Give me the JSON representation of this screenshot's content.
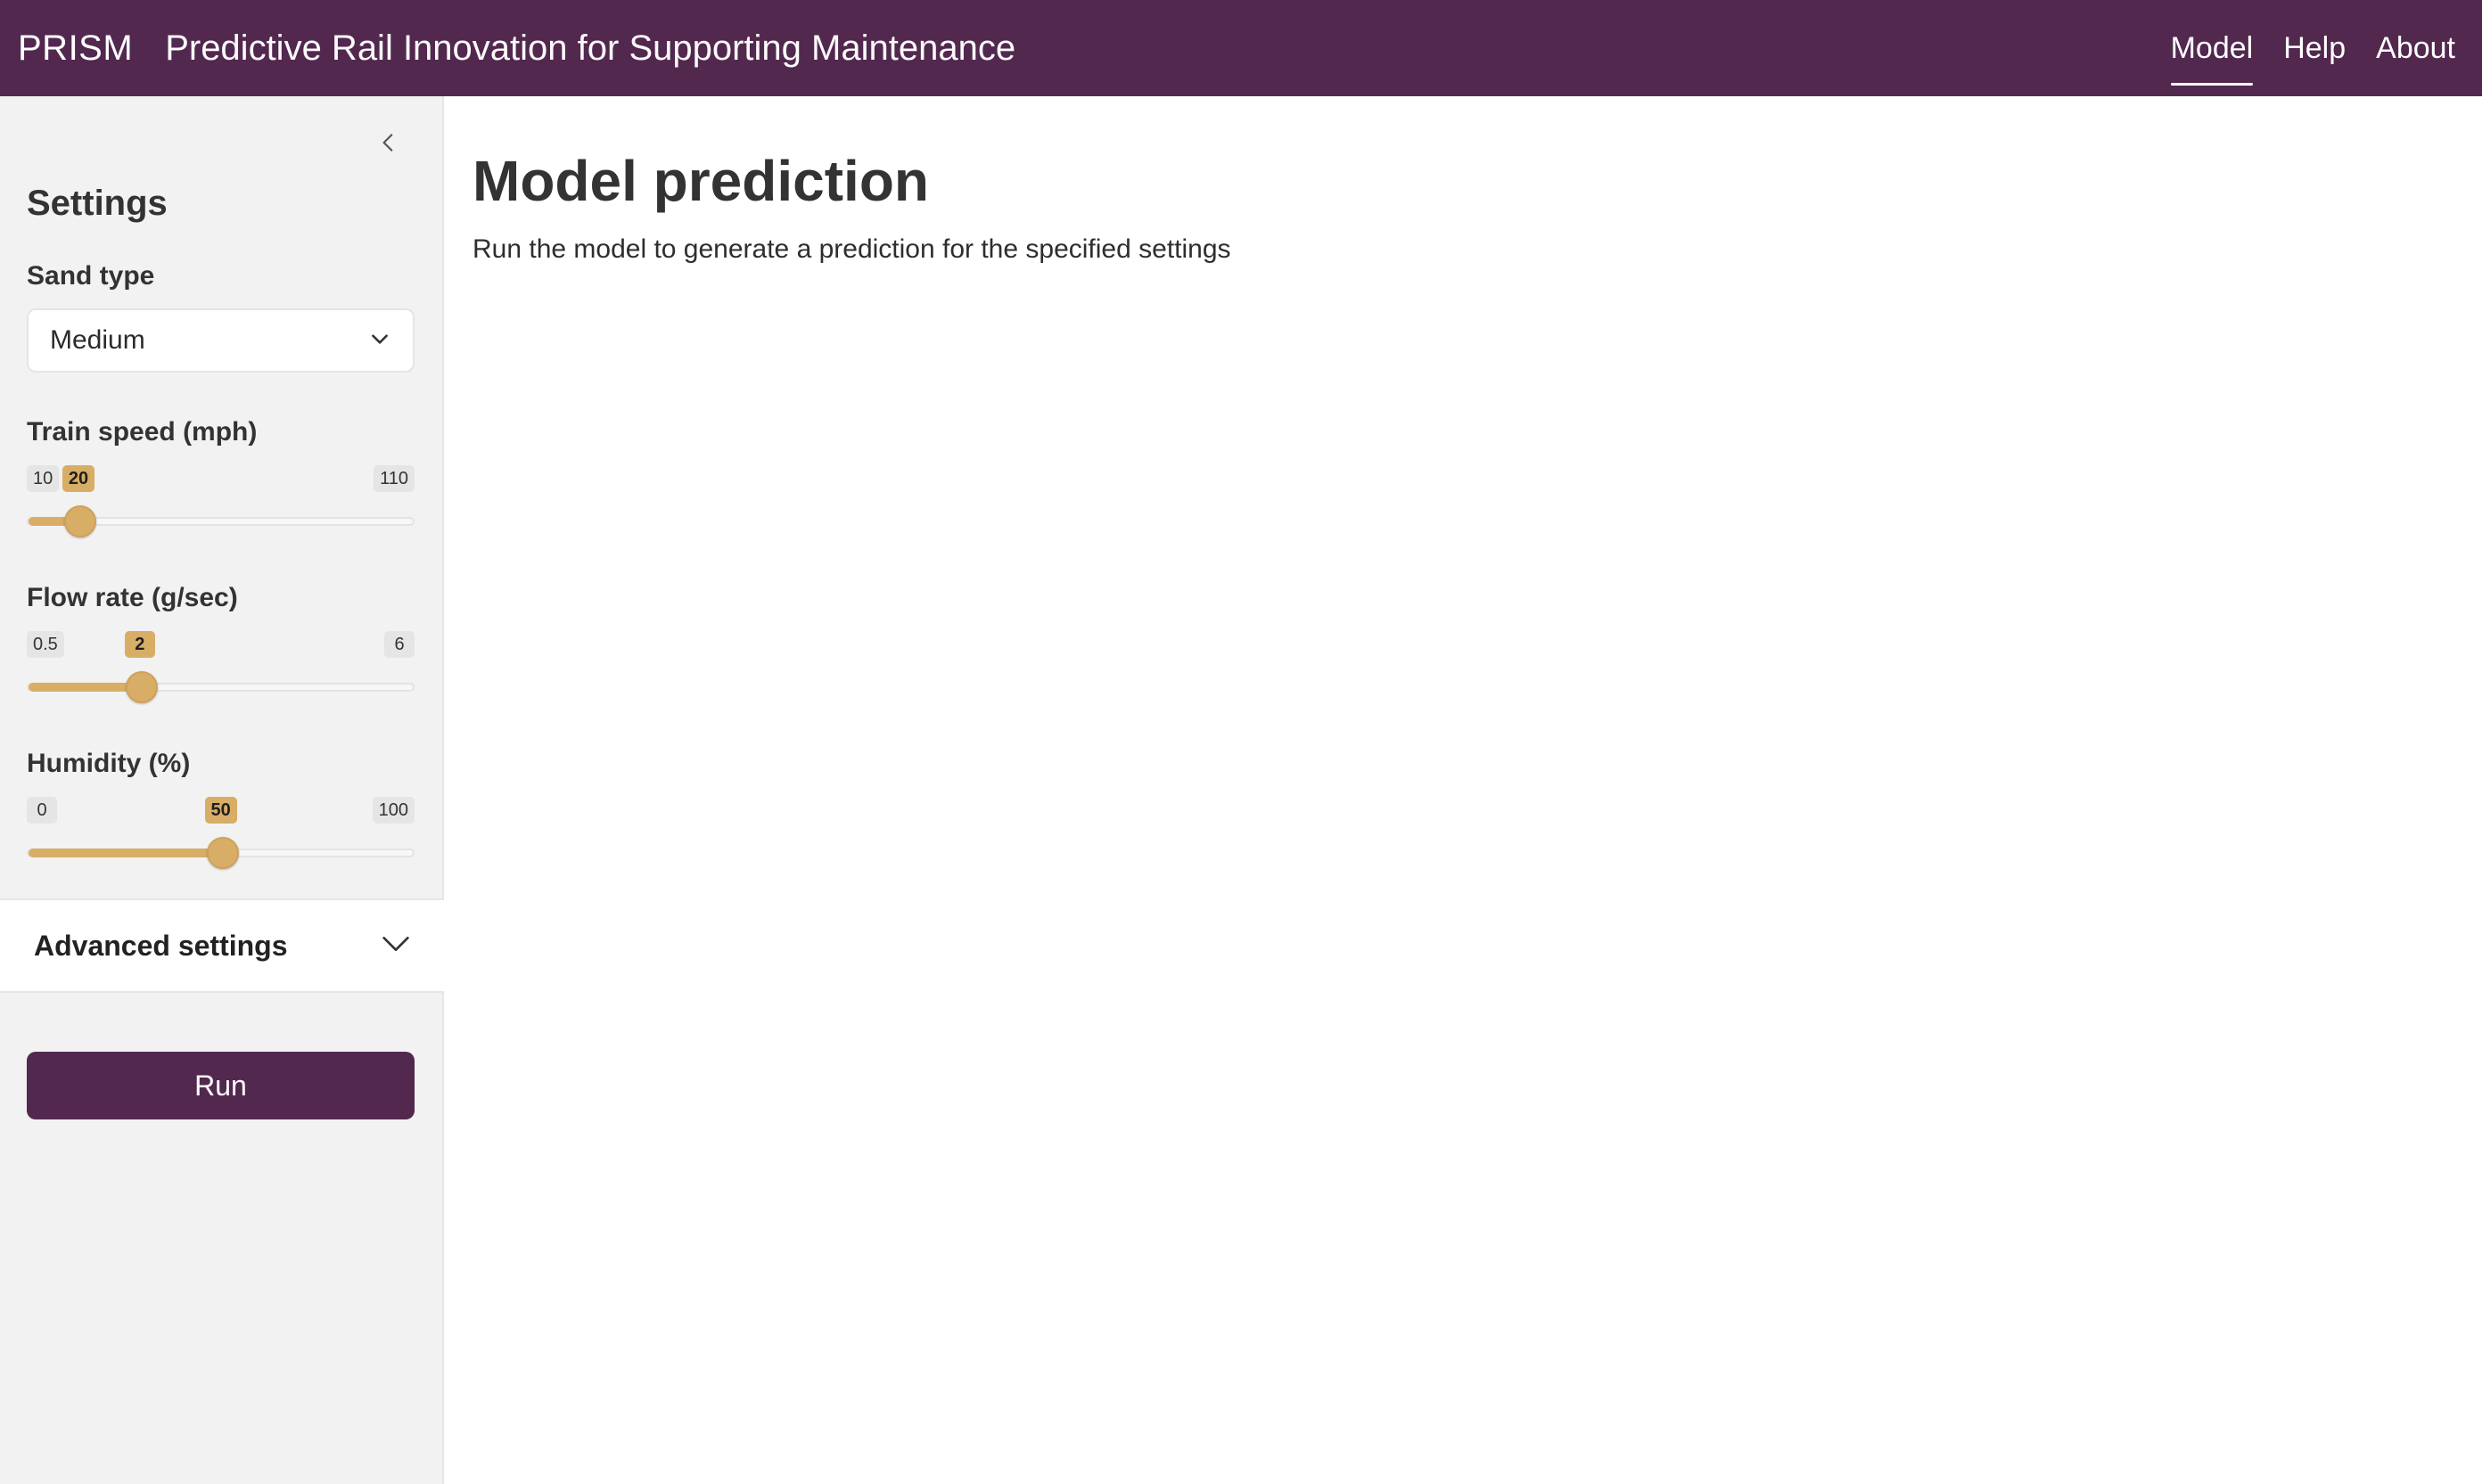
{
  "header": {
    "brand": "PRISM",
    "subtitle": "Predictive Rail Innovation for Supporting Maintenance",
    "nav": [
      {
        "label": "Model",
        "active": true
      },
      {
        "label": "Help",
        "active": false
      },
      {
        "label": "About",
        "active": false
      }
    ],
    "colors": {
      "brand": "#52284f"
    }
  },
  "sidebar": {
    "title": "Settings",
    "sand_type": {
      "label": "Sand type",
      "value": "Medium"
    },
    "sliders": {
      "train_speed": {
        "label": "Train speed (mph)",
        "min": 10,
        "max": 110,
        "value": 20
      },
      "flow_rate": {
        "label": "Flow rate (g/sec)",
        "min": 0.5,
        "max": 6,
        "value": 2
      },
      "humidity": {
        "label": "Humidity (%)",
        "min": 0,
        "max": 100,
        "value": 50
      }
    },
    "advanced": {
      "label": "Advanced settings"
    },
    "run_label": "Run",
    "colors": {
      "accent": "#d8ad65"
    },
    "icons": {
      "collapse": "chevron-left-icon",
      "dropdown": "chevron-down-icon"
    }
  },
  "main": {
    "title": "Model prediction",
    "description": "Run the model to generate a prediction for the specified settings"
  }
}
